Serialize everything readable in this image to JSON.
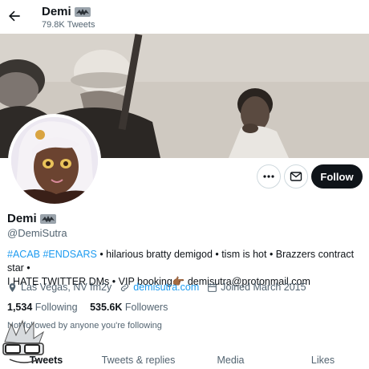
{
  "header": {
    "title": "Demi",
    "tweet_count": "79.8K Tweets"
  },
  "profile": {
    "name": "Demi",
    "handle": "@DemiSutra",
    "bio": {
      "hashtags": "#ACAB #ENDSARS",
      "line1_rest": " • hilarious bratty demigod • tism is hot • Brazzers contract star •",
      "line2": "I HATE TWITTER DMs • VIP booking👉🏾 demisutra@protonmail.com"
    },
    "location": "Las Vegas, NV fm2y",
    "website": "demisutra.com",
    "joined": "Joined March 2015",
    "following_count": "1,534",
    "following_label": "Following",
    "followers_count": "535.6K",
    "followers_label": "Followers",
    "followed_by": "Not followed by anyone you're following"
  },
  "actions": {
    "follow_label": "Follow"
  },
  "tabs": [
    {
      "label": "Tweets"
    },
    {
      "label": "Tweets & replies"
    },
    {
      "label": "Media"
    },
    {
      "label": "Likes"
    }
  ],
  "colors": {
    "accent": "#1d9bf0",
    "text": "#0f1419",
    "muted": "#536471",
    "follow_bg": "#0f1419"
  },
  "icons": [
    "back-arrow-icon",
    "bat-emoji-icon",
    "more-icon",
    "mail-icon",
    "location-icon",
    "link-icon",
    "calendar-icon"
  ]
}
